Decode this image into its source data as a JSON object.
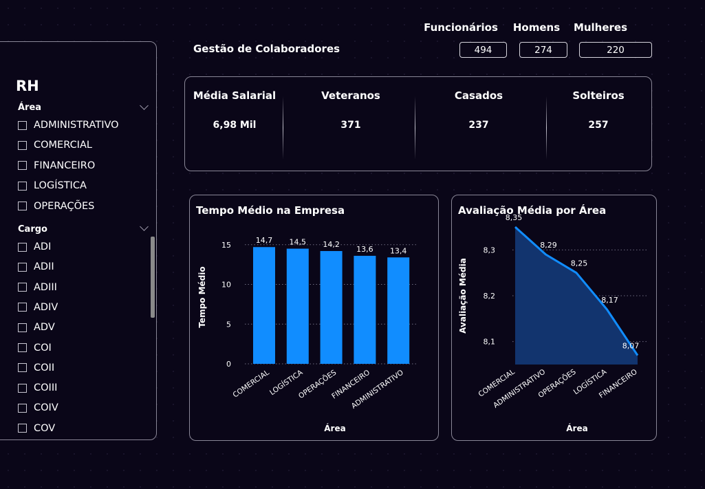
{
  "sidebar": {
    "title": "RH",
    "area_label": "Área",
    "area_options": [
      "ADMINISTRATIVO",
      "COMERCIAL",
      "FINANCEIRO",
      "LOGÍSTICA",
      "OPERAÇÕES"
    ],
    "cargo_label": "Cargo",
    "cargo_options": [
      "ADI",
      "ADII",
      "ADIII",
      "ADIV",
      "ADV",
      "COI",
      "COII",
      "COIII",
      "COIV",
      "COV"
    ]
  },
  "header": {
    "title": "Gestão de Colaboradores",
    "stats": [
      {
        "label": "Funcionários",
        "value": "494"
      },
      {
        "label": "Homens",
        "value": "274"
      },
      {
        "label": "Mulheres",
        "value": "220"
      }
    ]
  },
  "kpis": [
    {
      "label": "Média Salarial",
      "value": "6,98 Mil"
    },
    {
      "label": "Veteranos",
      "value": "371"
    },
    {
      "label": "Casados",
      "value": "237"
    },
    {
      "label": "Solteiros",
      "value": "257"
    }
  ],
  "colors": {
    "bar": "#118dff",
    "line": "#118dff",
    "area_fill": "#12346e",
    "panel_border": "#8a8797",
    "background": "#0a0618"
  },
  "chart_data": [
    {
      "type": "bar",
      "title": "Tempo Médio na Empresa",
      "xlabel": "Área",
      "ylabel": "Tempo Médio",
      "categories": [
        "COMERCIAL",
        "LOGÍSTICA",
        "OPERAÇÕES",
        "FINANCEIRO",
        "ADMINISTRATIVO"
      ],
      "values": [
        14.7,
        14.5,
        14.2,
        13.6,
        13.4
      ],
      "value_labels": [
        "14,7",
        "14,5",
        "14,2",
        "13,6",
        "13,4"
      ],
      "yticks": [
        "0",
        "5",
        "10",
        "15"
      ],
      "ytick_values": [
        0,
        5,
        10,
        15
      ],
      "ylim": [
        0,
        15.5
      ],
      "grid": true
    },
    {
      "type": "area",
      "title": "Avaliação Média por Área",
      "xlabel": "Área",
      "ylabel": "Avaliação Média",
      "categories": [
        "COMERCIAL",
        "ADMINISTRATIVO",
        "OPERAÇÕES",
        "LOGÍSTICA",
        "FINANCEIRO"
      ],
      "values": [
        8.35,
        8.29,
        8.25,
        8.17,
        8.07
      ],
      "value_labels": [
        "8,35",
        "8,29",
        "8,25",
        "8,17",
        "8,07"
      ],
      "yticks": [
        "8,1",
        "8,2",
        "8,3"
      ],
      "ytick_values": [
        8.1,
        8.2,
        8.3
      ],
      "ylim": [
        8.05,
        8.35
      ],
      "grid": true
    }
  ]
}
